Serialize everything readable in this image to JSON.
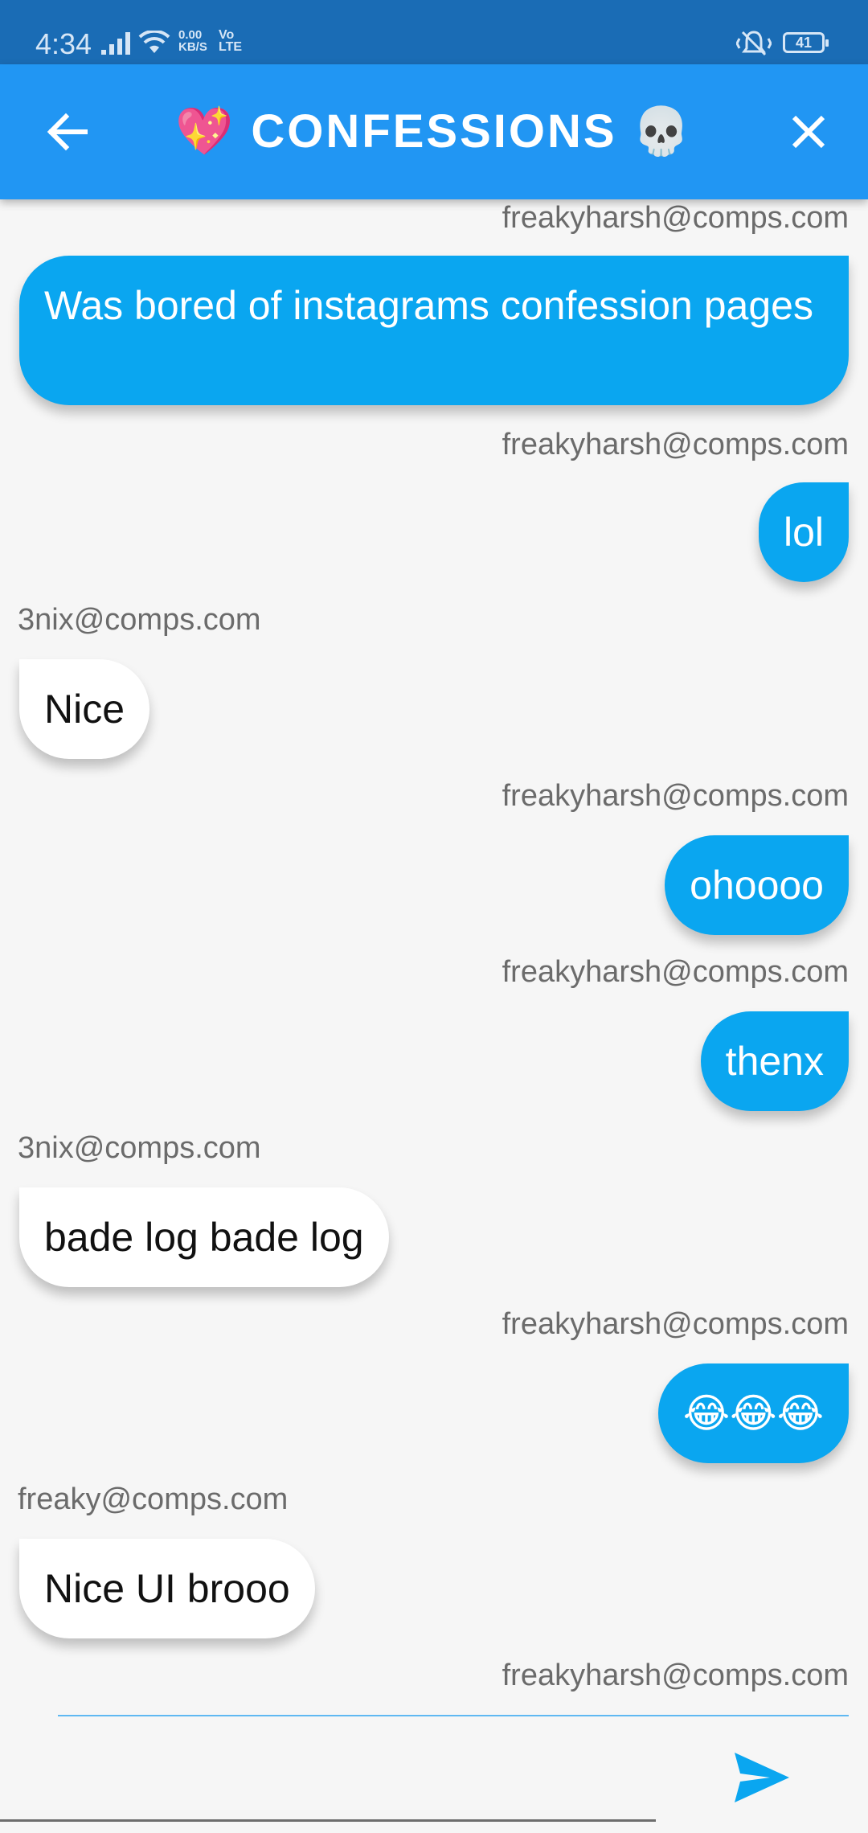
{
  "status_bar": {
    "time": "4:34",
    "speed_value": "0.00",
    "speed_unit": "KB/S",
    "network_top": "Vo",
    "network_bottom": "LTE",
    "battery": "41"
  },
  "app_bar": {
    "title": "💖 CONFESSIONS 💀",
    "back_icon": "arrow-left-icon",
    "close_icon": "close-icon",
    "color": "#2196f3"
  },
  "messages": [
    {
      "sender": "freakyharsh@comps.com",
      "text": "Was bored of instagrams confession pages",
      "mine": true
    },
    {
      "sender": "freakyharsh@comps.com",
      "text": "lol",
      "mine": true
    },
    {
      "sender": "3nix@comps.com",
      "text": "Nice",
      "mine": false
    },
    {
      "sender": "freakyharsh@comps.com",
      "text": "ohoooo",
      "mine": true
    },
    {
      "sender": "freakyharsh@comps.com",
      "text": "thenx",
      "mine": true
    },
    {
      "sender": "3nix@comps.com",
      "text": "bade log bade log",
      "mine": false
    },
    {
      "sender": "freakyharsh@comps.com",
      "text": "😂😂😂",
      "mine": true
    },
    {
      "sender": "freaky@comps.com",
      "text": "Nice UI brooo",
      "mine": false
    },
    {
      "sender": "freakyharsh@comps.com",
      "text": "",
      "mine": true
    }
  ],
  "composer": {
    "input_value": "",
    "send_icon": "send-icon",
    "accent": "#0aa6f0"
  }
}
